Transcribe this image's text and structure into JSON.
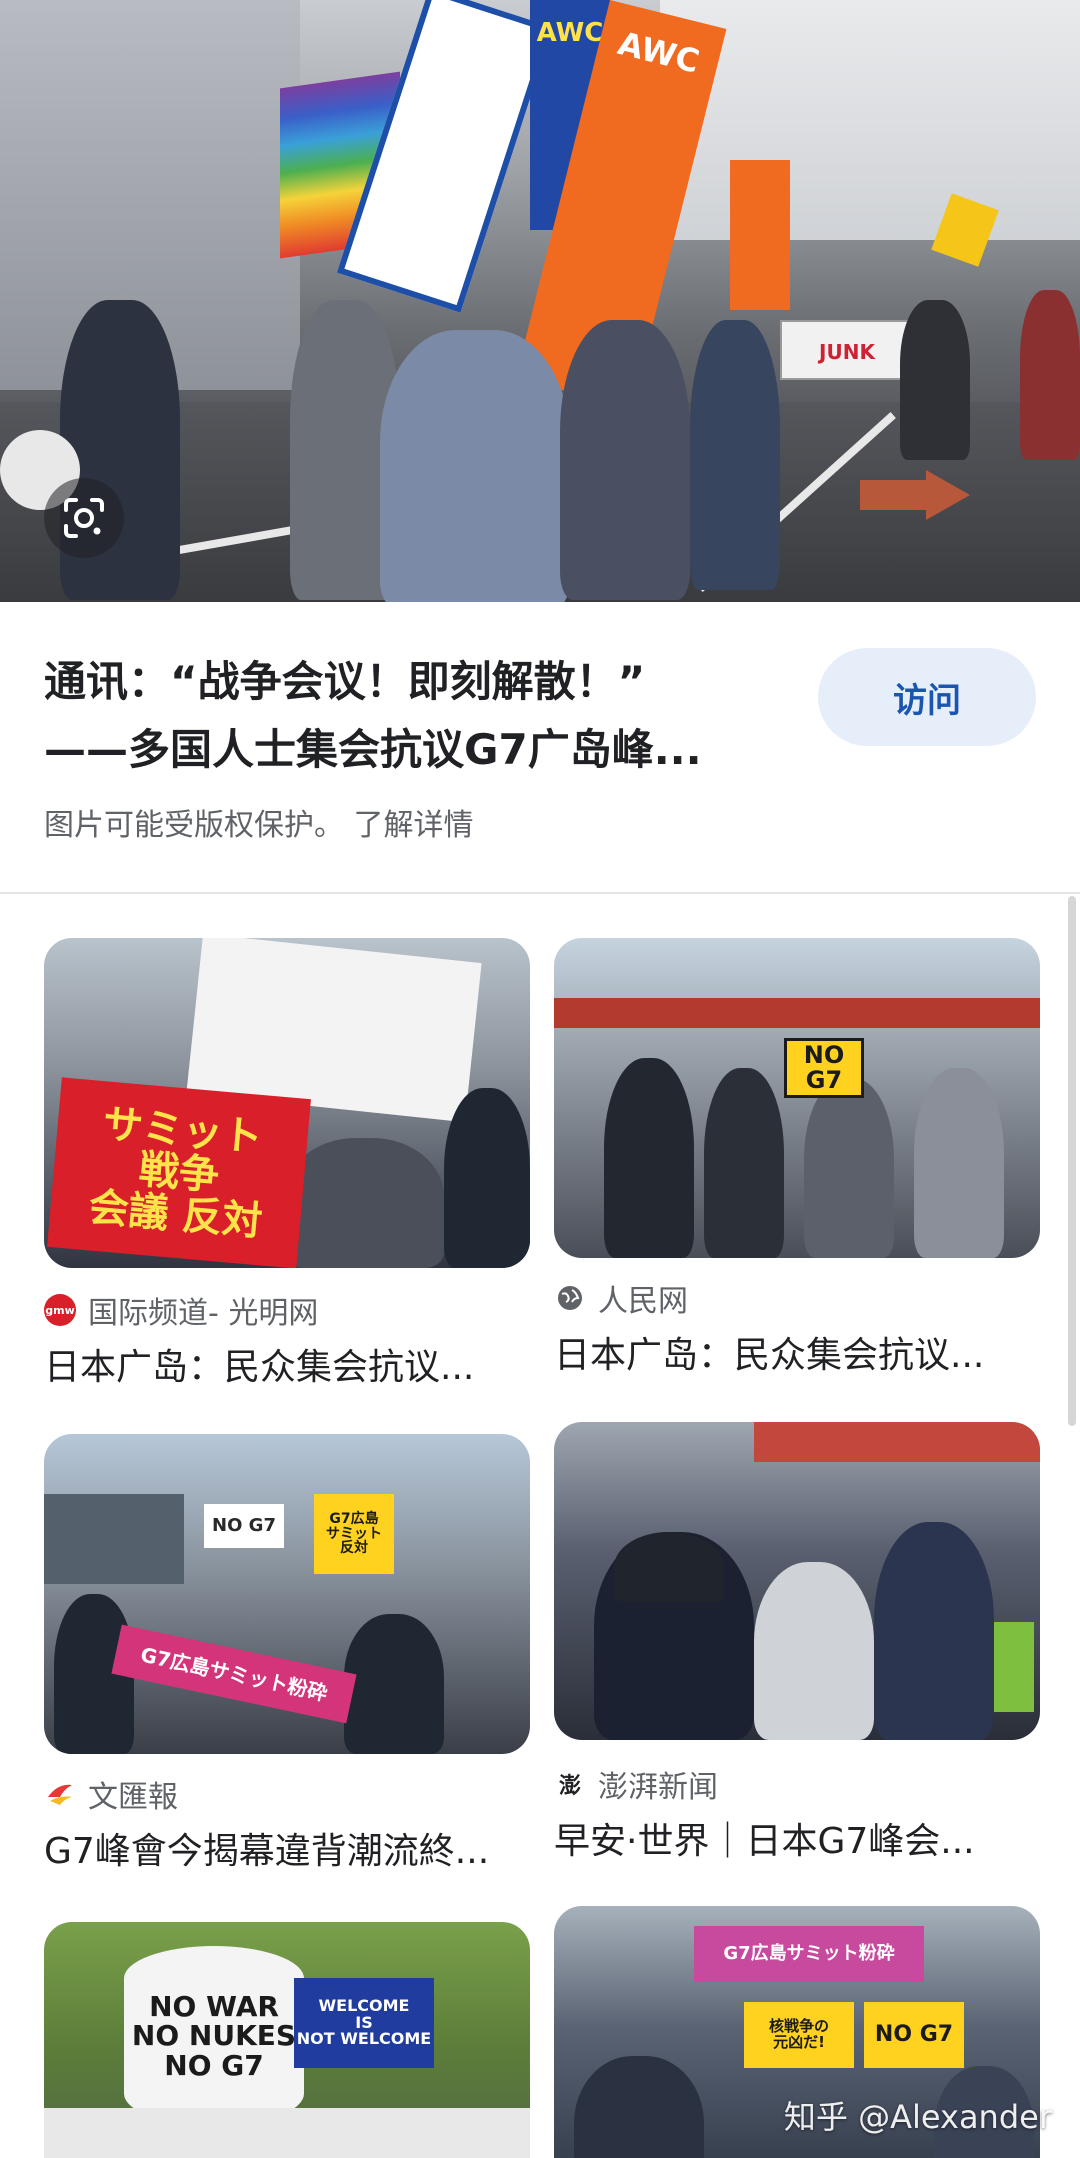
{
  "hero": {
    "flags": [
      "AWC",
      "AWC",
      "JUNK"
    ],
    "lens_icon": "google-lens-icon"
  },
  "result": {
    "title_line1": "通讯：“战争会议！即刻解散！”",
    "title_line2": "——多国人士集会抗议G7广岛峰...",
    "visit_label": "访问",
    "copyright_text": "图片可能受版权保护。",
    "learn_more": "了解详情"
  },
  "cards": [
    {
      "source": "国际频道- 光明网",
      "caption": "日本广岛：民众集会抗议...",
      "sign1": "サミット\n戦争\n会議 反対",
      "favicon": "gmw-icon"
    },
    {
      "source": "人民网",
      "caption": "日本广岛：民众集会抗议...",
      "sign1": "NO G7",
      "favicon": "globe-icon"
    },
    {
      "source": "文匯報",
      "caption": "G7峰會今揭幕違背潮流終...",
      "sign1": "NO G7",
      "sign2": "G7広島\nサミット\n反対",
      "banner": "G7広島サミット粉砕",
      "favicon": "wenweipo-icon"
    },
    {
      "source": "澎湃新闻",
      "caption": "早安·世界｜日本G7峰会...",
      "favicon": "thepaper-icon"
    },
    {
      "sign1": "NO WAR\nNO NUKES\nNO G7",
      "sign2": "WELCOME\nIS\nNOT WELCOME"
    },
    {
      "banner": "G7広島サミット粉砕",
      "sign1": "NO G7",
      "sign2": "核戦争の\n元凶だ!"
    }
  ],
  "watermark": "知乎 @Alexander",
  "colors": {
    "accent": "#1a56b0",
    "visit_bg": "#e6eefa",
    "muted": "#5f6368"
  }
}
